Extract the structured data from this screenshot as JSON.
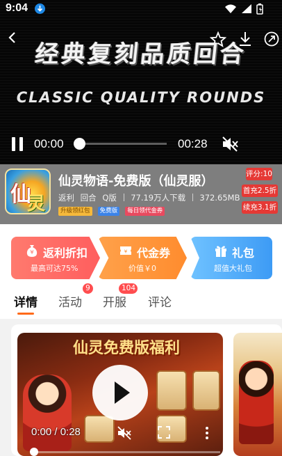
{
  "status_bar": {
    "time": "9:04"
  },
  "video": {
    "title_cn": "经典复刻品质回合",
    "title_en": "CLASSIC QUALITY ROUNDS",
    "current_time": "00:00",
    "total_time": "00:28",
    "progress": 0
  },
  "game": {
    "name": "仙灵物语-免费版（仙灵服）",
    "meta": {
      "type1": "返利",
      "type2": "回合",
      "type3": "Q版",
      "downloads": "77.19万人下载",
      "size": "372.65MB"
    },
    "tags": [
      "升级领红包",
      "免费版",
      "每日领代金券"
    ],
    "badges": {
      "score": "评分:10",
      "first_charge": "首充2.5折",
      "recharge": "续充3.1折"
    },
    "icon_chars": [
      "仙",
      "灵"
    ]
  },
  "promos": [
    {
      "title": "返利折扣",
      "sub": "最高可达75%"
    },
    {
      "title": "代金券",
      "sub": "价值￥0"
    },
    {
      "title": "礼包",
      "sub": "超值大礼包"
    }
  ],
  "tabs": {
    "items": [
      {
        "label": "详情"
      },
      {
        "label": "活动",
        "badge": "9"
      },
      {
        "label": "开服",
        "badge": "104"
      },
      {
        "label": "评论"
      }
    ]
  },
  "media": {
    "banner_text": "仙灵免费版福利",
    "time": "0:00 / 0:28",
    "progress": 0
  },
  "colors": {
    "accent": "#ff6a1a",
    "badge_red": "#e53935",
    "tag_blue": "#3b83e8"
  }
}
